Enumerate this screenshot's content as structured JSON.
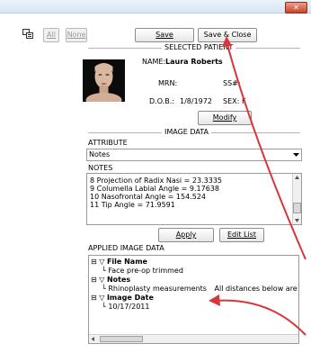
{
  "toolbar": {
    "all_label": "All",
    "none_label": "None",
    "save_label": "Save",
    "save_close_label": "Save & Close"
  },
  "window": {
    "close_symbol": "✕"
  },
  "patient": {
    "section_title": "SELECTED PATIENT",
    "name_label": "NAME:",
    "name_value": "Laura Roberts",
    "mrn_label": "MRN:",
    "ss_label": "SS#:",
    "dob_label": "D.O.B.:",
    "dob_value": "1/8/1972",
    "sex_label": "SEX:",
    "sex_value": "F",
    "modify_label": "Modify"
  },
  "image_data": {
    "section_title": "IMAGE DATA",
    "attribute_label": "ATTRIBUTE",
    "attribute_value": "Notes",
    "notes_label": "NOTES",
    "notes_lines": [
      "8  Projection of Radix Nasi  = 23.3335",
      "9  Columella Labial Angle  = 9.17638",
      "10 Nasofrontal Angle          = 154.524",
      "11 Tip Angle                       = 71.9591"
    ],
    "apply_label": "Apply",
    "edit_list_label": "Edit List"
  },
  "applied": {
    "label": "APPLIED IMAGE DATA",
    "items": [
      {
        "title": "File Name",
        "value": "Face pre-op trimmed",
        "extra": ""
      },
      {
        "title": "Notes",
        "value": "Rhinoplasty measurements",
        "extra": "All distances below are repo"
      },
      {
        "title": "Image Date",
        "value": "10/17/2011",
        "extra": ""
      }
    ]
  }
}
